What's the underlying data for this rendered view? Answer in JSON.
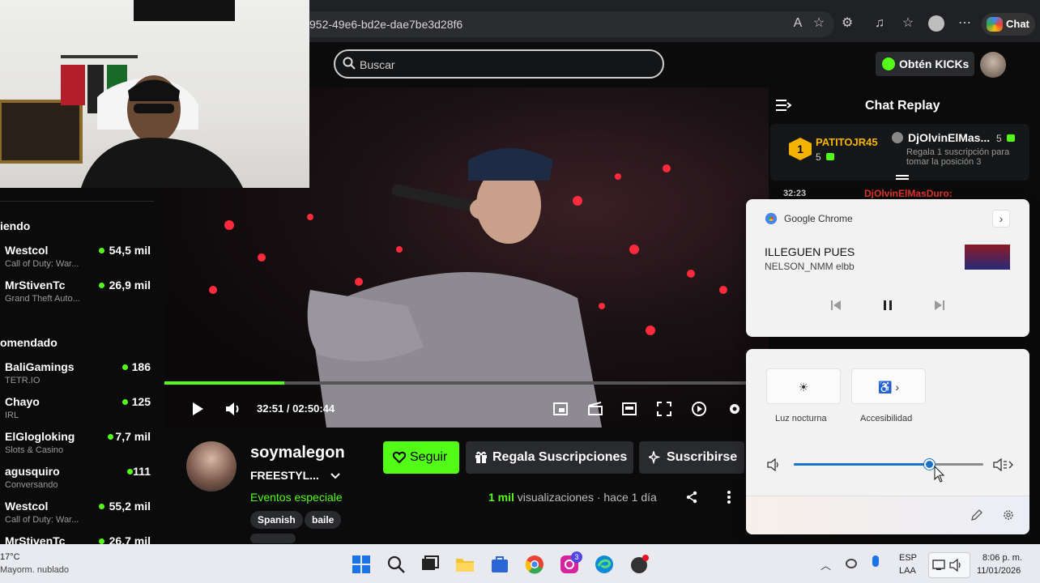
{
  "browser": {
    "url_fragment": "952-49e6-bd2e-dae7be3d28f6",
    "chat_label": "Chat",
    "toolbar_icons": [
      "read-aloud-icon",
      "star-icon",
      "extensions-icon",
      "media-icon",
      "favorites-icon",
      "profile-icon",
      "more-icon"
    ]
  },
  "site": {
    "search_placeholder": "Buscar",
    "kicks_label": "Obtén KICKs"
  },
  "player": {
    "time": "32:51 / 02:50:44",
    "progress": 0.2,
    "accent": "#53fc18"
  },
  "sidebar": {
    "section1": "iendo",
    "section2": "omendado",
    "following": [
      {
        "name": "Westcol",
        "sub": "Call of Duty: War...",
        "viewers": "54,5 mil"
      },
      {
        "name": "MrStivenTc",
        "sub": "Grand Theft Auto...",
        "viewers": "26,9 mil"
      }
    ],
    "recommended": [
      {
        "name": "BaliGamings",
        "sub": "TETR.IO",
        "viewers": "186"
      },
      {
        "name": "Chayo",
        "sub": "IRL",
        "viewers": "125"
      },
      {
        "name": "ElGlogloking",
        "sub": "Slots & Casino",
        "viewers": "7,7 mil"
      },
      {
        "name": "agusquiro",
        "sub": "Conversando",
        "viewers": "111"
      },
      {
        "name": "Westcol",
        "sub": "Call of Duty: War...",
        "viewers": "55,2 mil"
      },
      {
        "name": "MrStivenTc",
        "sub": "",
        "viewers": "26,7 mil"
      }
    ]
  },
  "channel": {
    "name": "soymalegon",
    "title": "FREESTYL...",
    "category": "Eventos especiale",
    "tags": [
      "Spanish",
      "baile"
    ],
    "follow_label": "Seguir",
    "gift_label": "Regala Suscripciones",
    "subscribe_label": "Suscribirse",
    "views_count": "1 mil",
    "views_text": " visualizaciones  ·  hace 1 día"
  },
  "chat": {
    "title": "Chat Replay",
    "leader_rank": "1",
    "leader_name": "PATITOJR45",
    "leader_count": "5",
    "gifter_name": "DjOlvinElMas...",
    "gifter_count": "5",
    "gifter_msg": "Regala 1 suscripción para tomar la posición 3",
    "msg_time": "32:23",
    "msg_user": "DjOlvinElMasDuro:"
  },
  "media": {
    "app": "Google Chrome",
    "track": "ILLEGUEN PUES",
    "artist": "NELSON_NMM elbb"
  },
  "quick": {
    "night_label": "Luz nocturna",
    "access_label": "Accesibilidad",
    "volume": 0.72
  },
  "taskbar": {
    "weather_temp": "17°C",
    "weather_desc": "Mayorm. nublado",
    "lang1": "ESP",
    "lang2": "LAA",
    "time": "8:06 p. m.",
    "date": "11/01/2026",
    "badge": "3"
  }
}
